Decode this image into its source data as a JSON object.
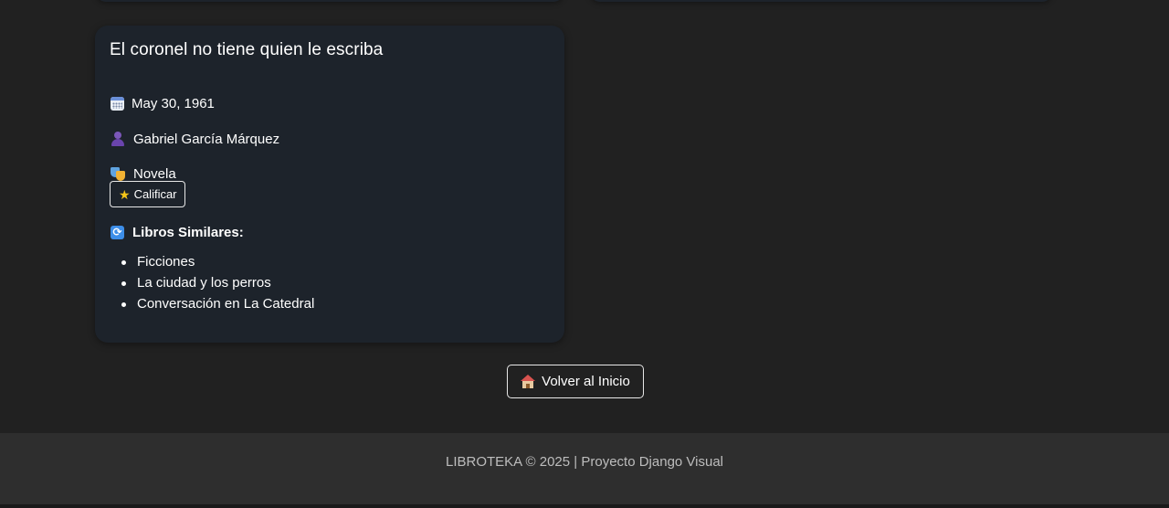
{
  "book": {
    "title": "El coronel no tiene quien le escriba",
    "date": "May 30, 1961",
    "author": "Gabriel García Márquez",
    "genre": "Novela",
    "rate_label": "Calificar",
    "similar_heading": "Libros Similares:",
    "similar": [
      "Ficciones",
      "La ciudad y los perros",
      "Conversación en La Catedral"
    ]
  },
  "actions": {
    "home_label": "Volver al Inicio"
  },
  "footer": {
    "text": "LIBROTEKA © 2025 | Proyecto Django Visual"
  },
  "colors": {
    "page_background": "#212121",
    "card_background": "#1d232b",
    "footer_background": "#2e2e2e"
  },
  "icons": {
    "date": "calendar-icon",
    "author": "person-icon",
    "genre": "masks-icon",
    "rate": "star-icon",
    "similar": "repeat-icon",
    "home": "house-icon"
  }
}
